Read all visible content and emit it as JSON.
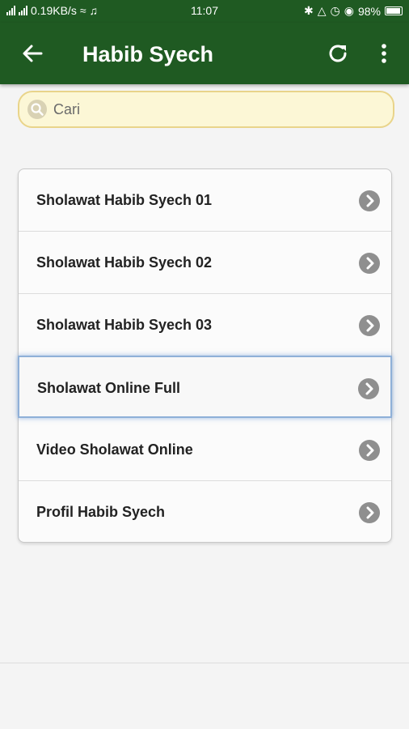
{
  "status_bar": {
    "net_speed": "0.19KB/s",
    "time": "11:07",
    "battery": "98%"
  },
  "app_bar": {
    "title": "Habib Syech",
    "icons": [
      "back-arrow-icon",
      "refresh-icon",
      "more-vert-icon"
    ]
  },
  "search": {
    "placeholder": "Cari",
    "value": ""
  },
  "menu": {
    "items": [
      {
        "label": "Sholawat Habib Syech 01"
      },
      {
        "label": "Sholawat Habib Syech 02"
      },
      {
        "label": "Sholawat Habib Syech 03"
      },
      {
        "label": "Sholawat Online Full"
      },
      {
        "label": "Video Sholawat Online"
      },
      {
        "label": "Profil Habib Syech"
      }
    ],
    "focused_index": 3
  },
  "colors": {
    "app_bar": "#1f5a22",
    "search_bg": "#fcf7d6",
    "search_border": "#e9d48a",
    "chevron": "#8f8f8f",
    "focus_ring": "#8fb0d8"
  }
}
